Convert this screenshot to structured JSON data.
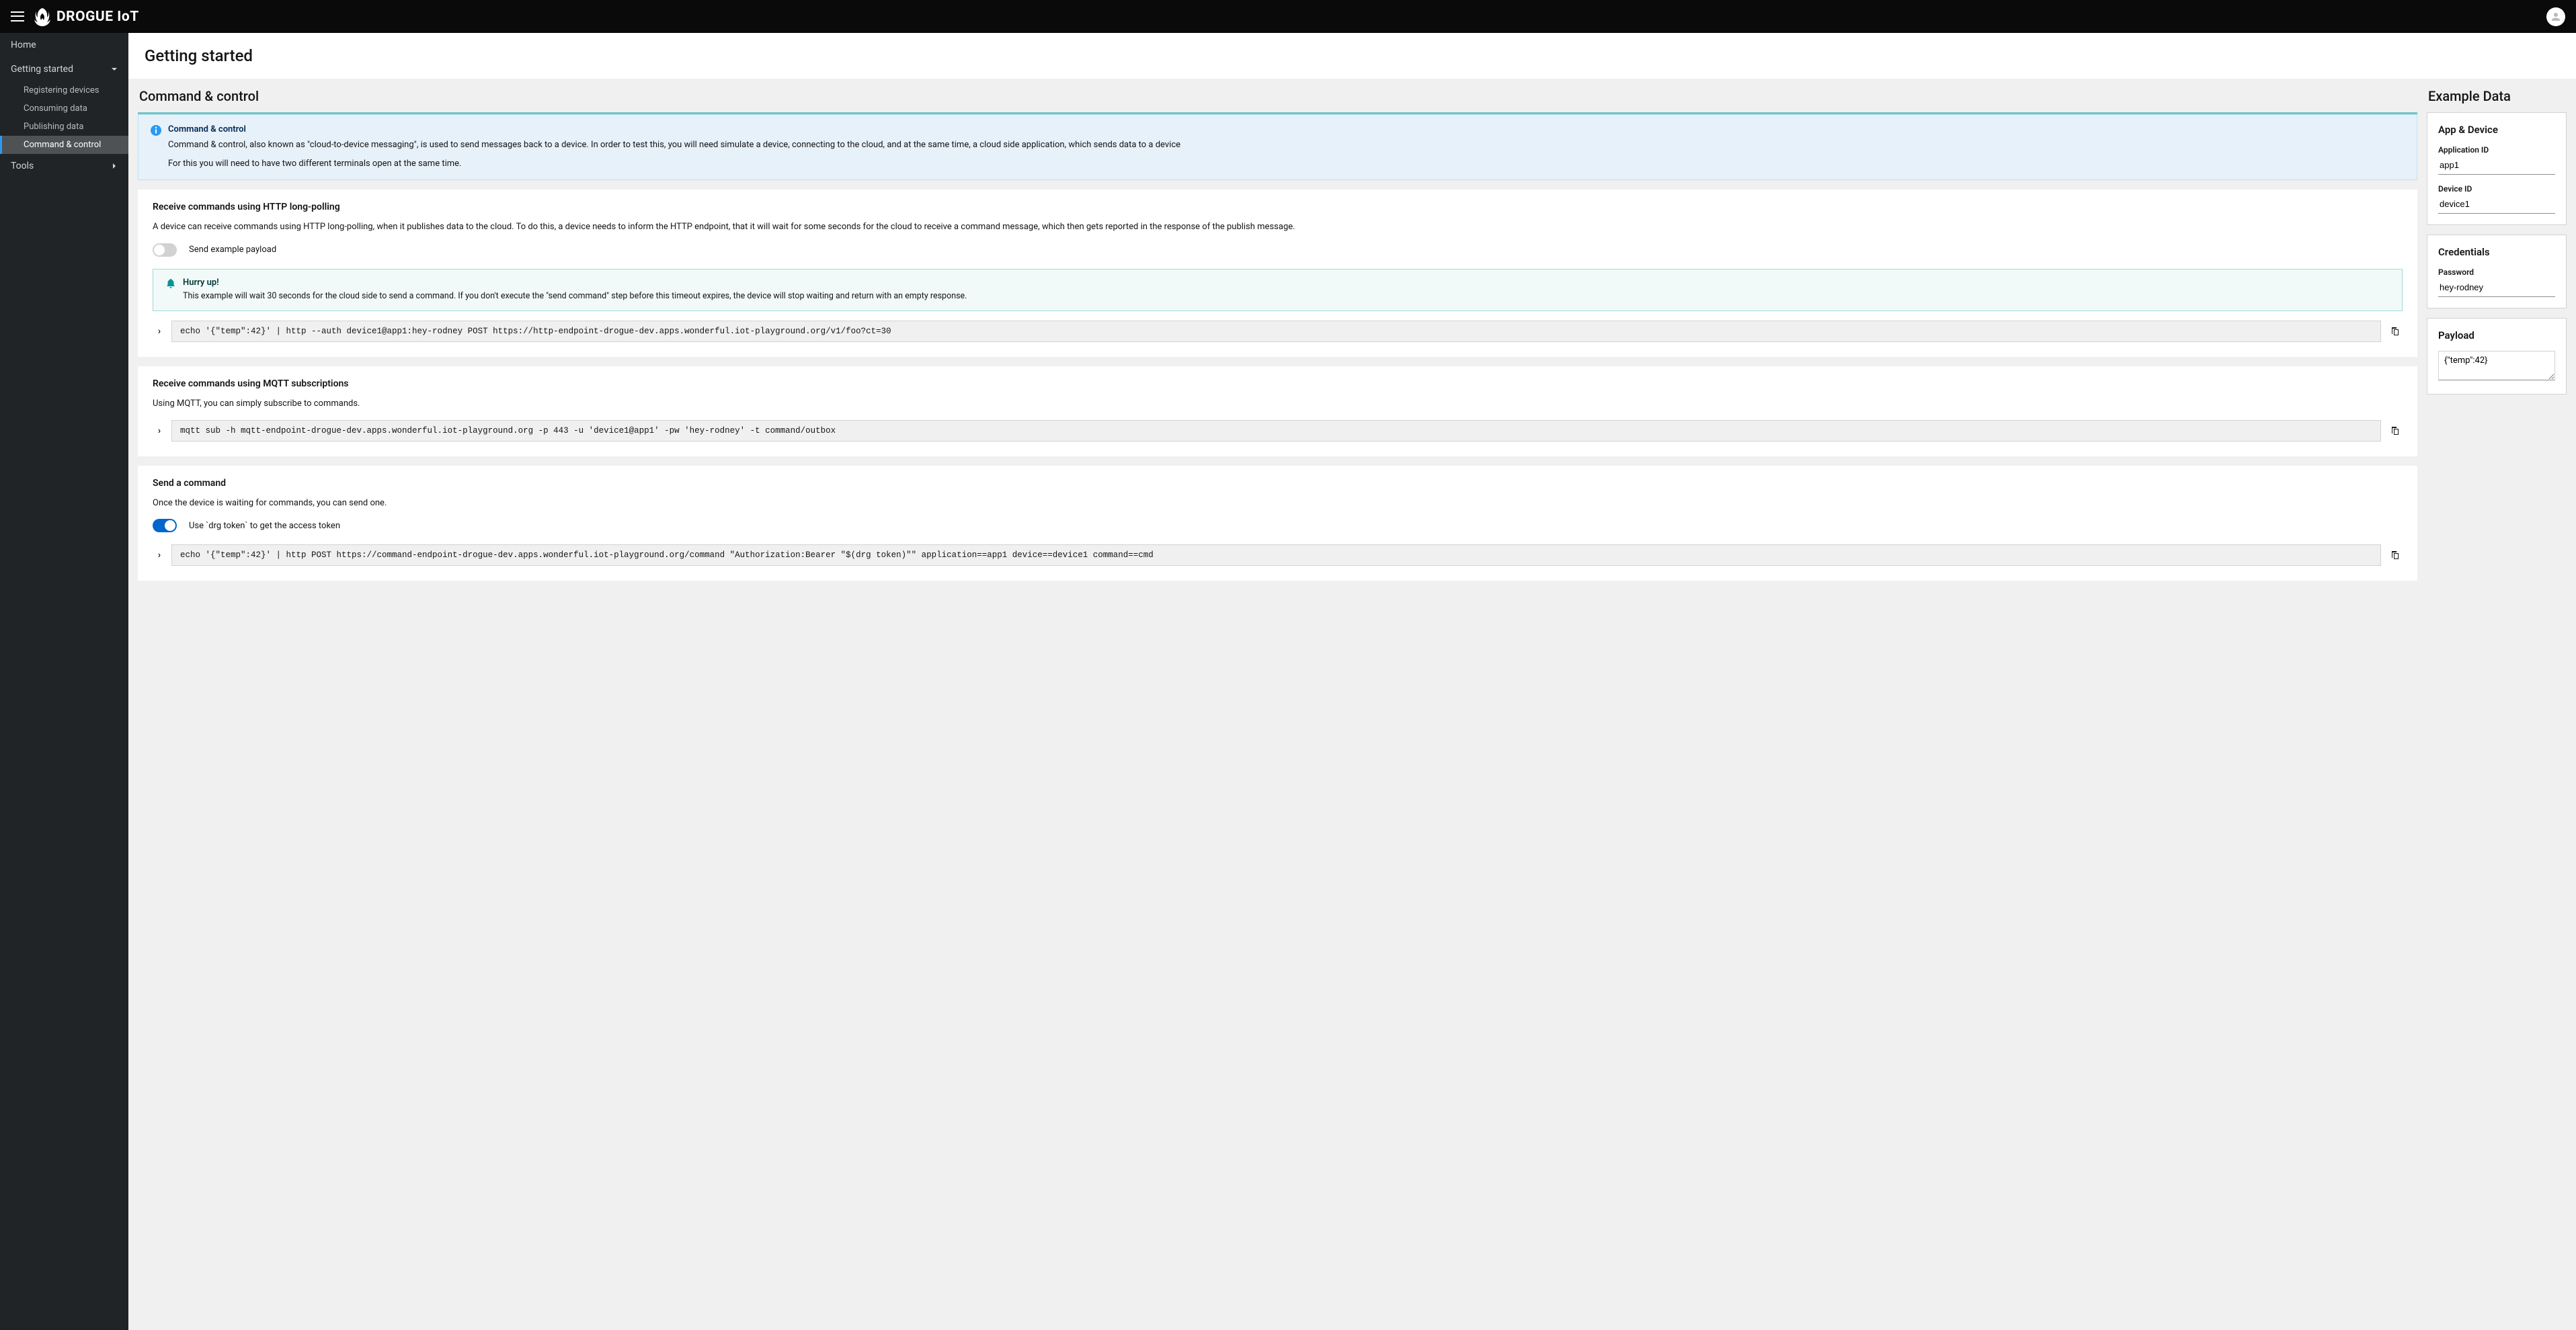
{
  "brand": {
    "name": "DROGUE IoT"
  },
  "sidebar": {
    "home": "Home",
    "getting_started": "Getting started",
    "subs": [
      "Registering devices",
      "Consuming data",
      "Publishing data",
      "Command & control"
    ],
    "tools": "Tools"
  },
  "page_title": "Getting started",
  "section_title": "Command & control",
  "alert1": {
    "title": "Command & control",
    "p1": "Command & control, also known as \"cloud-to-device messaging\", is used to send messages back to a device. In order to test this, you will need simulate a device, connecting to the cloud, and at the same time, a cloud side application, which sends data to a device",
    "p2": "For this you will need to have two different terminals open at the same time."
  },
  "http": {
    "title": "Receive commands using HTTP long-polling",
    "desc": "A device can receive commands using HTTP long-polling, when it publishes data to the cloud. To do this, a device needs to inform the HTTP endpoint, that it will wait for some seconds for the cloud to receive a command message, which then gets reported in the response of the publish message.",
    "switch_label": "Send example payload",
    "warn_title": "Hurry up!",
    "warn_text": "This example will wait 30 seconds for the cloud side to send a command. If you don't execute the \"send command\" step before this timeout expires, the device will stop waiting and return with an empty response.",
    "cmd": "echo '{\"temp\":42}' | http --auth device1@app1:hey-rodney POST https://http-endpoint-drogue-dev.apps.wonderful.iot-playground.org/v1/foo?ct=30"
  },
  "mqtt": {
    "title": "Receive commands using MQTT subscriptions",
    "desc": "Using MQTT, you can simply subscribe to commands.",
    "cmd": "mqtt sub -h mqtt-endpoint-drogue-dev.apps.wonderful.iot-playground.org -p 443 -u 'device1@app1' -pw 'hey-rodney' -t command/outbox"
  },
  "send": {
    "title": "Send a command",
    "desc": "Once the device is waiting for commands, you can send one.",
    "switch_label": "Use `drg token` to get the access token",
    "cmd": "echo '{\"temp\":42}' | http POST https://command-endpoint-drogue-dev.apps.wonderful.iot-playground.org/command \"Authorization:Bearer \"$(drg token)\"\" application==app1 device==device1 command==cmd"
  },
  "side": {
    "title": "Example Data",
    "app_device": "App & Device",
    "app_id_label": "Application ID",
    "app_id": "app1",
    "device_id_label": "Device ID",
    "device_id": "device1",
    "credentials": "Credentials",
    "password_label": "Password",
    "password": "hey-rodney",
    "payload": "Payload",
    "payload_value": "{\"temp\":42}"
  }
}
